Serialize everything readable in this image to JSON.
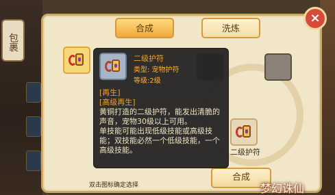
{
  "side": {
    "bag_label": "包裹"
  },
  "tabs": [
    {
      "label": "合成",
      "active": true
    },
    {
      "label": "洗炼",
      "active": false
    }
  ],
  "tooltip": {
    "name": "二级护符",
    "type": "类型: 宠物护符",
    "level": "等级:2级",
    "tag1": "[再生]",
    "tag2": "[高级再生]",
    "desc1": "黄铜打造的二级护符，能发出清脆的声音，宠物30级以上可用。",
    "desc2": "单技能可能出现低级技能或高级技能；双技能必然一个低级技能，一个高级技能。"
  },
  "result": {
    "label": "二级护符"
  },
  "buttons": {
    "compose": "合成",
    "close": "×"
  },
  "hint": "双击图标确定选择",
  "logo": "梦幻诛仙",
  "colors": {
    "accent": "#f0a93a",
    "tooltip_title": "#f0a12a",
    "close": "#d64a3a"
  },
  "icons": {
    "item": "amulet-icon",
    "close": "close-icon"
  }
}
